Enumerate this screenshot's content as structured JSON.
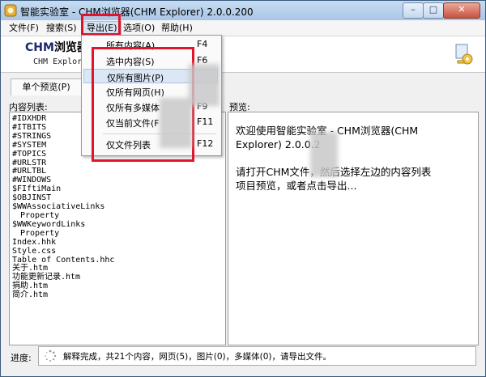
{
  "window": {
    "title": "智能实验室 - CHM浏览器(CHM Explorer) 2.0.0.200",
    "controls": {
      "minimize": "–",
      "maximize": "□",
      "close": "✕"
    }
  },
  "menubar": {
    "items": [
      "文件(F)",
      "搜索(S)",
      "导出(E)",
      "选项(O)",
      "帮助(H)"
    ]
  },
  "export_menu": {
    "items": [
      {
        "label": "所有内容(A)",
        "shortcut": "F4"
      },
      {
        "label": "选中内容(S)",
        "shortcut": "F6"
      },
      {
        "label": "仅所有图片(P)",
        "shortcut": ""
      },
      {
        "label": "仅所有网页(H)",
        "shortcut": ""
      },
      {
        "label": "仅所有多媒体",
        "shortcut": "F9"
      },
      {
        "label": "仅当前文件(F",
        "shortcut": "F11"
      },
      {
        "label": "仅文件列表",
        "shortcut": "F12"
      }
    ]
  },
  "banner": {
    "title_lead": "CHM",
    "title_rest": "浏览器",
    "subtitle": "CHM Explor"
  },
  "tabs": {
    "preview": "单个预览(P)"
  },
  "content_list": {
    "label": "内容列表:",
    "items": [
      "#IDXHDR",
      "#ITBITS",
      "#STRINGS",
      "#SYSTEM",
      "#TOPICS",
      "#URLSTR",
      "#URLTBL",
      "#WINDOWS",
      "$FIftiMain",
      "$OBJINST",
      "$WWAssociativeLinks",
      "Property",
      "$WWKeywordLinks",
      "Property",
      "Index.hhk",
      "Style.css",
      "Table of Contents.hhc",
      "关于.htm",
      "功能更新记录.htm",
      "捐助.htm",
      "简介.htm"
    ],
    "indented": [
      11,
      13
    ]
  },
  "preview": {
    "label": "预览:",
    "line1": "欢迎使用智能实验室 - CHM浏览器(CHM",
    "line2": "Explorer) 2.0.0.2",
    "line3": "请打开CHM文件，然后选择左边的内容列表",
    "line4": "项目预览，或者点击导出..."
  },
  "status": {
    "label": "进度:",
    "text": "解释完成，共21个内容，网页(5)，图片(0)，多媒体(0)，请导出文件。"
  },
  "colors": {
    "highlight_box": "#e0152b",
    "menu_highlight": "#dbe7f5"
  }
}
